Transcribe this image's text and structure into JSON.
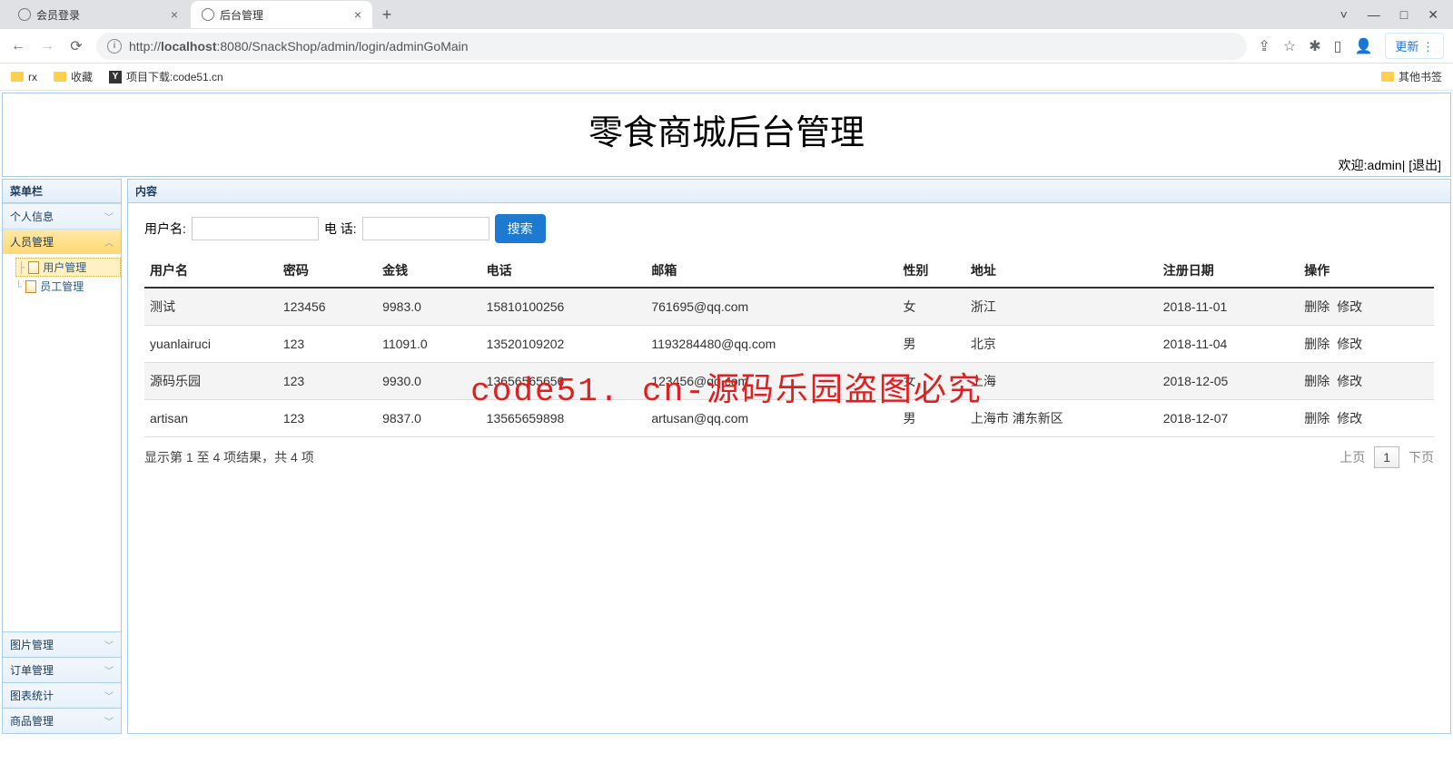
{
  "browser": {
    "tabs": [
      {
        "title": "会员登录"
      },
      {
        "title": "后台管理"
      }
    ],
    "url": "http://localhost:8080/SnackShop/admin/login/adminGoMain",
    "url_host": "localhost",
    "url_prefix": "http://",
    "url_suffix": ":8080/SnackShop/admin/login/adminGoMain",
    "update_label": "更新",
    "bookmarks": {
      "rx": "rx",
      "fav": "收藏",
      "dl": "项目下载:code51.cn",
      "other": "其他书签"
    }
  },
  "header": {
    "title": "零食商城后台管理",
    "welcome_prefix": "欢迎:",
    "welcome_user": "admin",
    "logout": "[退出]"
  },
  "sidebar": {
    "menu_label": "菜单栏",
    "items": {
      "personal": "个人信息",
      "personnel": "人员管理",
      "image": "图片管理",
      "order": "订单管理",
      "chart": "图表统计",
      "product": "商品管理"
    },
    "tree": {
      "user_mgmt": "用户管理",
      "staff_mgmt": "员工管理"
    }
  },
  "main": {
    "content_label": "内容",
    "search": {
      "username_label": "用户名:",
      "phone_label": "电 话:",
      "button": "搜索"
    },
    "columns": {
      "username": "用户名",
      "password": "密码",
      "money": "金钱",
      "phone": "电话",
      "email": "邮箱",
      "gender": "性别",
      "address": "地址",
      "regdate": "注册日期",
      "ops": "操作"
    },
    "rows": [
      {
        "username": "测试",
        "password": "123456",
        "money": "9983.0",
        "phone": "15810100256",
        "email": "761695@qq.com",
        "gender": "女",
        "address": "浙江",
        "regdate": "2018-11-01"
      },
      {
        "username": "yuanlairuci",
        "password": "123",
        "money": "11091.0",
        "phone": "13520109202",
        "email": "1193284480@qq.com",
        "gender": "男",
        "address": "北京",
        "regdate": "2018-11-04"
      },
      {
        "username": "源码乐园",
        "password": "123",
        "money": "9930.0",
        "phone": "13656565656",
        "email": "123456@qq.com",
        "gender": "女",
        "address": "上海",
        "regdate": "2018-12-05"
      },
      {
        "username": "artisan",
        "password": "123",
        "money": "9837.0",
        "phone": "13565659898",
        "email": "artusan@qq.com",
        "gender": "男",
        "address": "上海市 浦东新区",
        "regdate": "2018-12-07"
      }
    ],
    "ops": {
      "delete": "删除",
      "edit": "修改"
    },
    "footer": {
      "summary": "显示第 1 至 4 项结果，共 4 项",
      "prev": "上页",
      "page1": "1",
      "next": "下页"
    }
  },
  "watermark": "code51. cn-源码乐园盗图必究"
}
